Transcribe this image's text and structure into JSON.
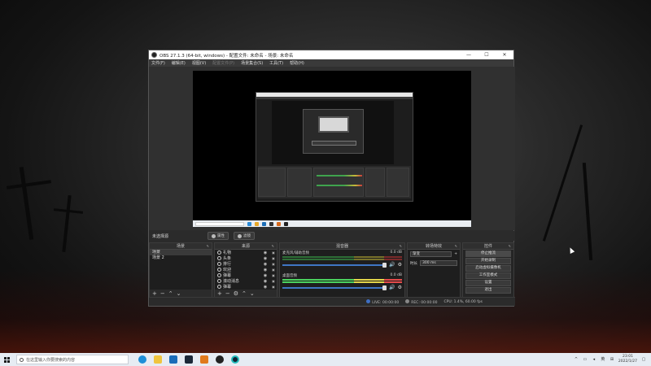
{
  "window": {
    "title": "OBS 27.1.3 (64-bit, windows) - 配置文件: 未命名 - 场景: 未命名",
    "minimize": "—",
    "maximize": "☐",
    "close": "✕"
  },
  "menu": [
    "文件(F)",
    "编辑(E)",
    "视图(V)",
    "配置文件(P)",
    "场景集合(S)",
    "工具(T)",
    "帮助(H)"
  ],
  "scene_bar": {
    "label": "未选择源",
    "properties_btn": "属性",
    "filters_btn": "滤镜"
  },
  "docks": {
    "scenes": {
      "title": "场景",
      "items": [
        "场景",
        "场景 2"
      ],
      "selected_index": 0
    },
    "sources": {
      "title": "来源",
      "items": [
        "礼物",
        "头条",
        "排行",
        "欢迎",
        "弹幕",
        "滚动消息",
        "弹幕"
      ]
    },
    "mixer": {
      "title": "混音器",
      "tracks": [
        {
          "name": "麦克风/辅助音频",
          "db": "0.0 dB"
        },
        {
          "name": "桌面音频",
          "db": "0.0 dB"
        }
      ],
      "ticks": [
        "-60",
        "-55",
        "-50",
        "-45",
        "-40",
        "-35",
        "-30",
        "-25",
        "-20",
        "-15",
        "-10",
        "-5",
        "0"
      ]
    },
    "transitions": {
      "title": "转场特效",
      "type": "渐变",
      "duration_label": "时长",
      "duration_value": "300 ms"
    },
    "controls": {
      "title": "控件",
      "buttons": [
        "停止推流",
        "开始录制",
        "启动虚拟摄像机",
        "工作室模式",
        "设置",
        "退出"
      ]
    }
  },
  "status": {
    "live_label": "LIVE:",
    "live_time": "00:00:00",
    "rec_label": "REC:",
    "rec_time": "00:00:00",
    "cpu": "CPU: 1.4%, 60.00 fps"
  },
  "taskbar": {
    "search_placeholder": "在这里输入你要搜索的内容",
    "time": "23:01",
    "date": "2022/1/27",
    "ime": "英"
  },
  "colors": {
    "obs_bg": "#2b2b2b",
    "dock_bg": "#1e1e1e",
    "fader_blue": "#3f76c4",
    "meter_green": "#4bd15f",
    "meter_yellow": "#e3d54a",
    "meter_red": "#e34a4a",
    "taskbar_bg": "#e6ecf3"
  }
}
